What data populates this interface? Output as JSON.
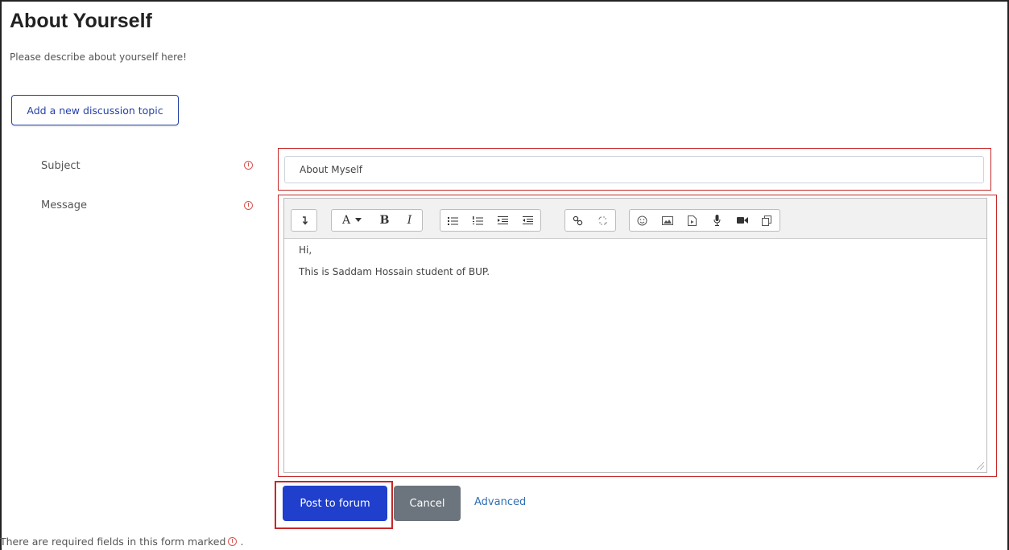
{
  "header": {
    "title": "About Yourself",
    "description": "Please describe about yourself here!"
  },
  "actions": {
    "add_topic_label": "Add a new discussion topic"
  },
  "form": {
    "subject_label": "Subject",
    "subject_value": "About Myself",
    "message_label": "Message",
    "message_lines": [
      "Hi,",
      "This is Saddam Hossain student of BUP."
    ]
  },
  "toolbar": {
    "font_label": "A",
    "bold_label": "B",
    "italic_label": "I"
  },
  "buttons": {
    "post_label": "Post to forum",
    "cancel_label": "Cancel",
    "advanced_label": "Advanced"
  },
  "footer": {
    "required_note_prefix": "There are required fields in this form marked",
    "required_note_suffix": "."
  },
  "colors": {
    "primary": "#1f3fcc",
    "secondary": "#6c757d",
    "highlight": "#c62828",
    "required": "#d9534f",
    "link": "#2f6fb3"
  },
  "icons": [
    "required-icon",
    "collapse-toolbar-icon",
    "font-color-icon",
    "bold-icon",
    "italic-icon",
    "unordered-list-icon",
    "ordered-list-icon",
    "indent-icon",
    "outdent-icon",
    "link-icon",
    "unlink-icon",
    "emoji-icon",
    "image-icon",
    "media-icon",
    "record-audio-icon",
    "record-video-icon",
    "manage-files-icon"
  ]
}
